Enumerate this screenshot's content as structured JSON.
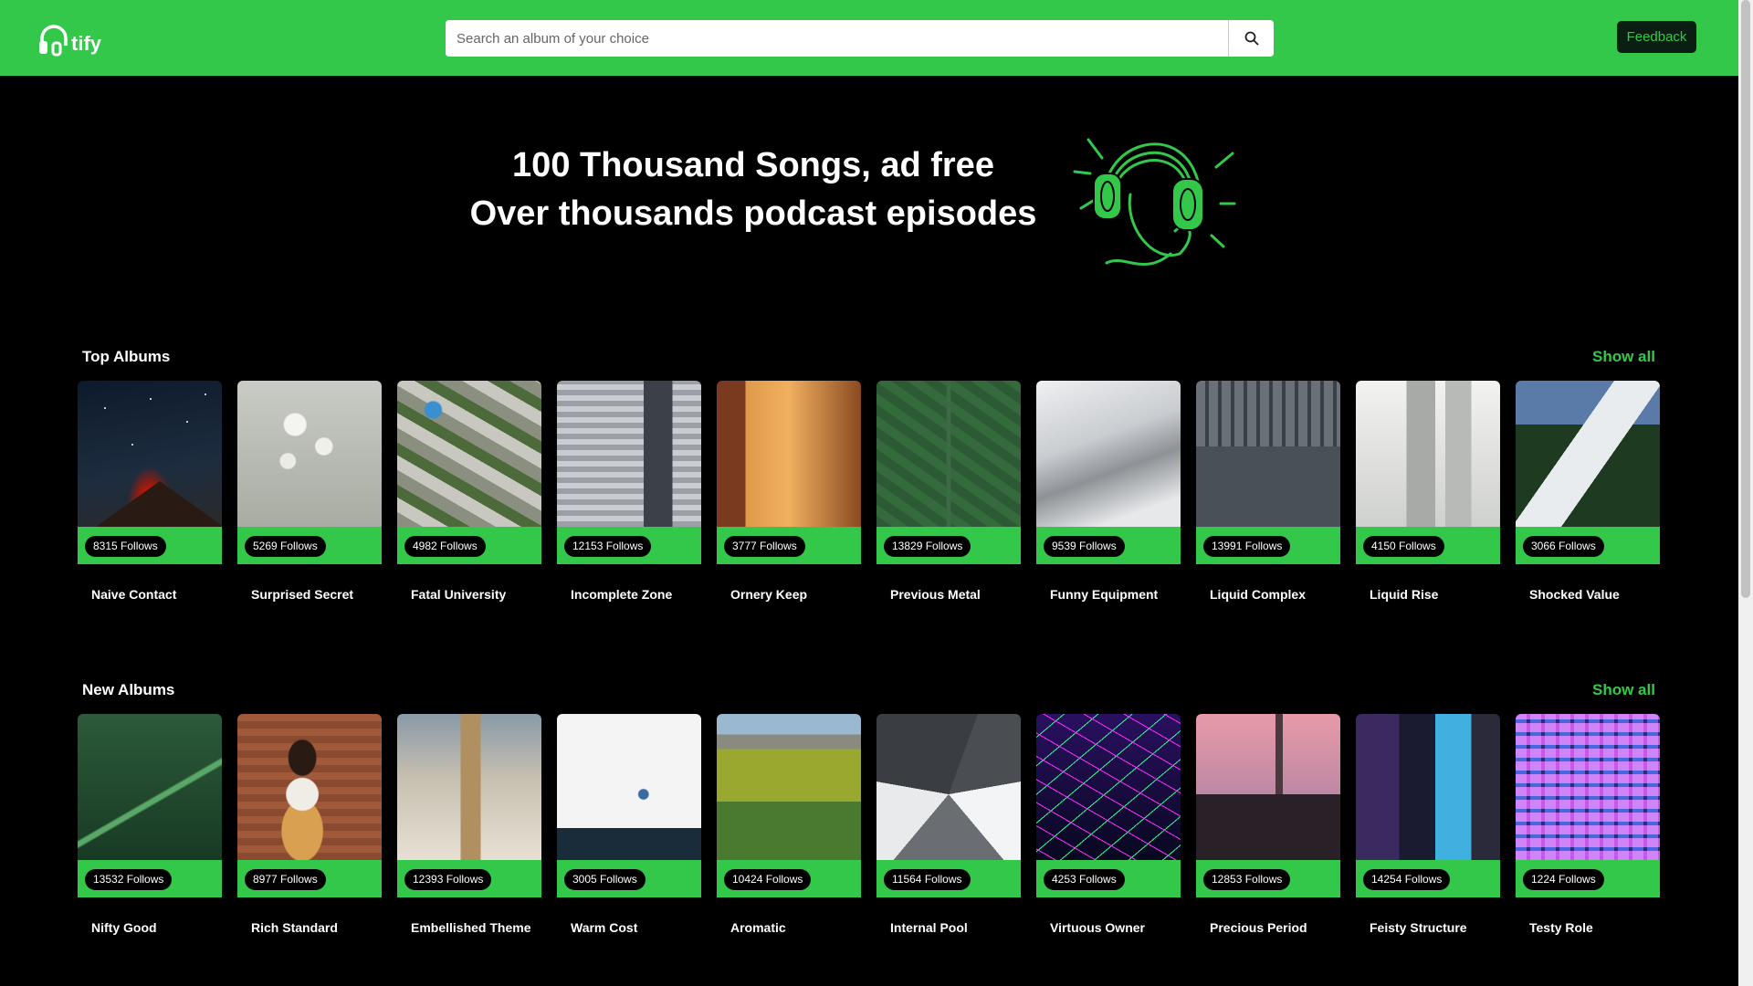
{
  "header": {
    "logo_text": "tify",
    "search_placeholder": "Search an album of your choice",
    "feedback_label": "Feedback"
  },
  "hero": {
    "line1": "100 Thousand Songs, ad free",
    "line2": "Over thousands podcast episodes"
  },
  "top_albums": {
    "title": "Top Albums",
    "show_all": "Show all",
    "items": [
      {
        "name": "Naive Contact",
        "follows": "8315 Follows"
      },
      {
        "name": "Surprised Secret",
        "follows": "5269 Follows"
      },
      {
        "name": "Fatal University",
        "follows": "4982 Follows"
      },
      {
        "name": "Incomplete Zone",
        "follows": "12153 Follows"
      },
      {
        "name": "Ornery Keep",
        "follows": "3777 Follows"
      },
      {
        "name": "Previous Metal",
        "follows": "13829 Follows"
      },
      {
        "name": "Funny Equipment",
        "follows": "9539 Follows"
      },
      {
        "name": "Liquid Complex",
        "follows": "13991 Follows"
      },
      {
        "name": "Liquid Rise",
        "follows": "4150 Follows"
      },
      {
        "name": "Shocked Value",
        "follows": "3066 Follows"
      }
    ]
  },
  "new_albums": {
    "title": "New Albums",
    "show_all": "Show all",
    "items": [
      {
        "name": "Nifty Good",
        "follows": "13532 Follows"
      },
      {
        "name": "Rich Standard",
        "follows": "8977 Follows"
      },
      {
        "name": "Embellished Theme",
        "follows": "12393 Follows"
      },
      {
        "name": "Warm Cost",
        "follows": "3005 Follows"
      },
      {
        "name": "Aromatic",
        "follows": "10424 Follows"
      },
      {
        "name": "Internal Pool",
        "follows": "11564 Follows"
      },
      {
        "name": "Virtuous Owner",
        "follows": "4253 Follows"
      },
      {
        "name": "Precious Period",
        "follows": "12853 Follows"
      },
      {
        "name": "Feisty Structure",
        "follows": "14254 Follows"
      },
      {
        "name": "Testy Role",
        "follows": "1224 Follows"
      }
    ]
  },
  "colors": {
    "brand_green": "#34c84a",
    "background": "#000000"
  }
}
